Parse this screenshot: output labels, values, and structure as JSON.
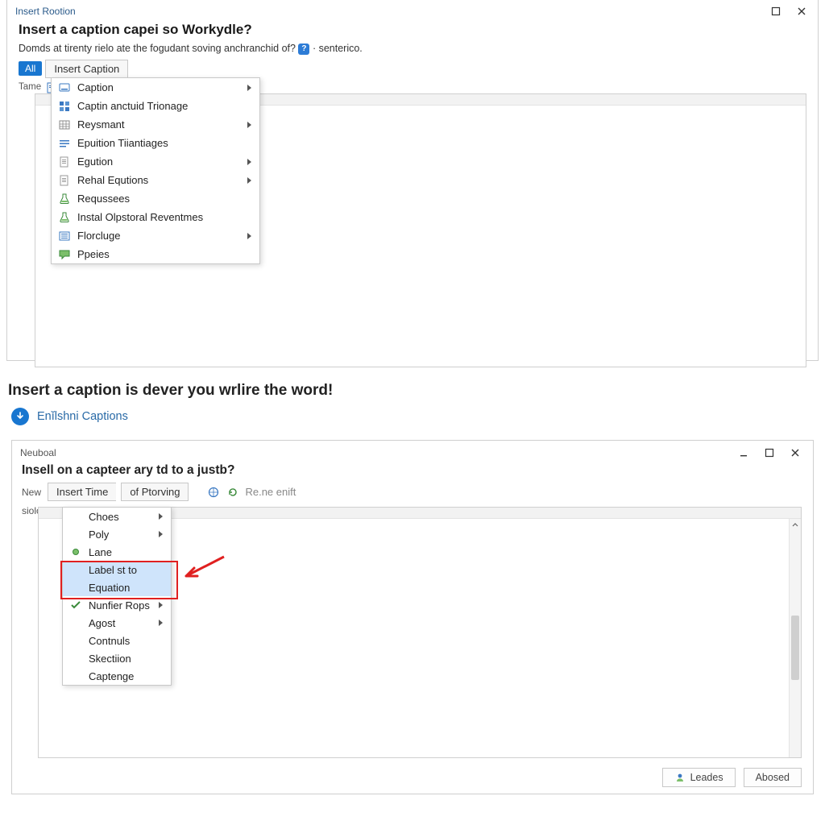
{
  "win1": {
    "title": "Insert Rootion",
    "heading": "Insert a caption capei so Workydle?",
    "subtext_pre": "Domds at tirenty rielo ate the fogudant soving anchranchid of?",
    "subtext_post": "· senterico.",
    "pill": "All",
    "tab": "Insert Caption",
    "side_label": "Tame",
    "menu": [
      {
        "icon": "caption-icon",
        "label": "Caption",
        "sub": true
      },
      {
        "icon": "grid-icon",
        "label": "Captin anctuid Trionage",
        "sub": false
      },
      {
        "icon": "table-icon",
        "label": "Reysmant",
        "sub": true
      },
      {
        "icon": "lines-icon",
        "label": "Epuition Tiiantiages",
        "sub": false
      },
      {
        "icon": "page-icon",
        "label": "Egution",
        "sub": true
      },
      {
        "icon": "page-icon",
        "label": "Rehal Equtions",
        "sub": true
      },
      {
        "icon": "flask-icon",
        "label": "Requssees",
        "sub": false
      },
      {
        "icon": "flask-icon",
        "label": "Instal Olpstoral Reventmes",
        "sub": false
      },
      {
        "icon": "list-icon",
        "label": "Florcluge",
        "sub": true
      },
      {
        "icon": "bubble-icon",
        "label": "Ppeies",
        "sub": false
      }
    ]
  },
  "mid": {
    "heading": "Insert a caption is dever you wrlire the word!",
    "link": "Enĭlshni Captions"
  },
  "win2": {
    "title": "Neuboal",
    "heading": "Insell on a capteer ary td to a justb?",
    "new_label": "New",
    "tab1": "Insert Time",
    "tab2": "of Ptorving",
    "extra": "Re.ne enift",
    "side_label": "siolor",
    "menu": [
      {
        "icon": "",
        "label": "Choes",
        "sub": true
      },
      {
        "icon": "",
        "label": "Poly",
        "sub": true
      },
      {
        "icon": "dot-icon",
        "label": "Lane",
        "sub": false
      },
      {
        "icon": "",
        "label": "Label st to",
        "sub": false,
        "hl": true
      },
      {
        "icon": "",
        "label": "Equation",
        "sub": false,
        "hl": true
      },
      {
        "icon": "check-icon",
        "label": "Nunfier Rops",
        "sub": true
      },
      {
        "icon": "",
        "label": "Agost",
        "sub": true
      },
      {
        "icon": "",
        "label": "Contnuls",
        "sub": false
      },
      {
        "icon": "",
        "label": "Skectiion",
        "sub": false
      },
      {
        "icon": "",
        "label": "Captenge",
        "sub": false
      }
    ],
    "btn_primary": "Leades",
    "btn_secondary": "Abosed"
  }
}
